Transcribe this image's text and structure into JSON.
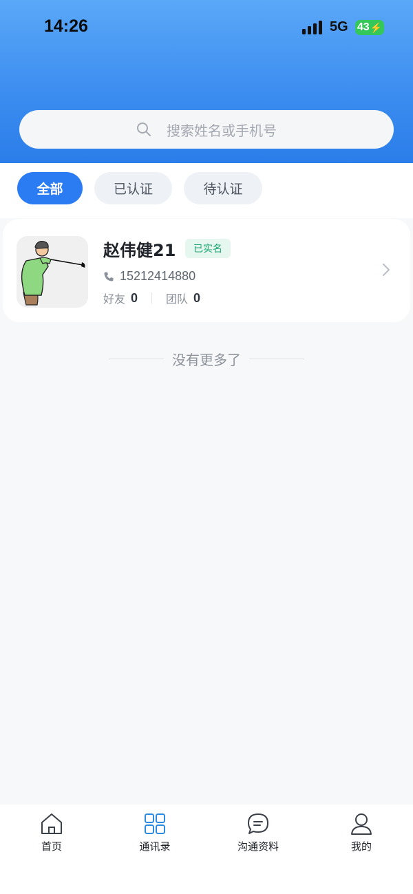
{
  "status_bar": {
    "time": "14:26",
    "network": "5G",
    "battery": "43"
  },
  "search": {
    "placeholder": "搜索姓名或手机号",
    "icon": "search-icon"
  },
  "filters": [
    {
      "label": "全部",
      "active": true
    },
    {
      "label": "已认证",
      "active": false
    },
    {
      "label": "待认证",
      "active": false
    }
  ],
  "contacts": [
    {
      "name": "赵伟健21",
      "badge": "已实名",
      "phone": "15212414880",
      "friends_label": "好友",
      "friends_count": "0",
      "team_label": "团队",
      "team_count": "0"
    }
  ],
  "list_footer": "没有更多了",
  "tabbar": [
    {
      "label": "首页",
      "icon": "home-icon"
    },
    {
      "label": "通讯录",
      "icon": "grid-icon",
      "active": true
    },
    {
      "label": "沟通资料",
      "icon": "chat-icon"
    },
    {
      "label": "我的",
      "icon": "user-icon"
    }
  ],
  "colors": {
    "accent": "#2b7bf2",
    "badge_green": "#1ea672",
    "header_top": "#5aa8f8",
    "header_bottom": "#2b7de9"
  }
}
